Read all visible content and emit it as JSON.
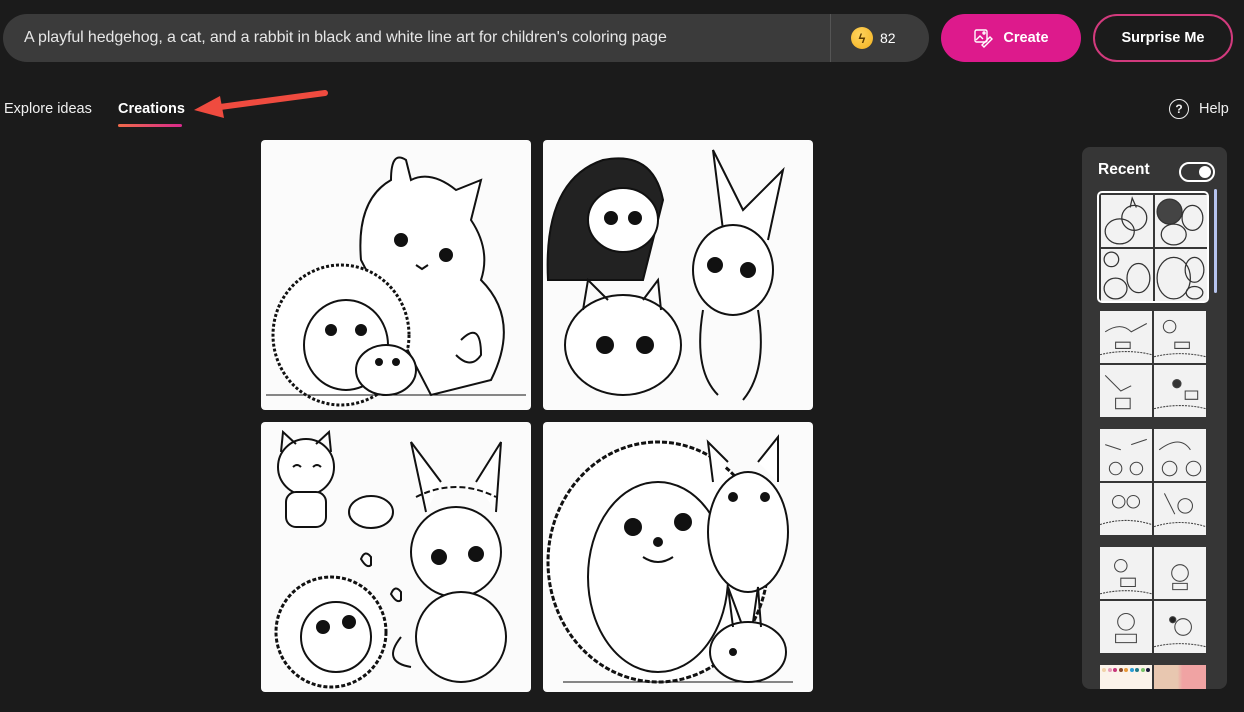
{
  "prompt": {
    "text": "A playful hedgehog, a cat, and a rabbit in black and white line art for children's coloring page"
  },
  "credits": {
    "icon": "lightning-coin-icon",
    "count": "82"
  },
  "buttons": {
    "create_label": "Create",
    "create_icon": "image-edit-icon",
    "surprise_label": "Surprise Me"
  },
  "tabs": [
    {
      "label": "Explore ideas",
      "active": false
    },
    {
      "label": "Creations",
      "active": true
    }
  ],
  "help": {
    "icon": "question-circle-icon",
    "label": "Help"
  },
  "annotation": {
    "arrow": "red-arrow-pointing-to-creations-tab"
  },
  "creations": [
    {
      "description": "Hedgehog, cat and rabbit line art - cat behind hedgehog, small rabbit front"
    },
    {
      "description": "Hedgehog waving, rabbit with long ears, cat lying in front"
    },
    {
      "description": "Smiling cat with bunny, hedgehog, rabbit with flower crown"
    },
    {
      "description": "Large standing hedgehog, cat and rabbit on the right"
    }
  ],
  "recent": {
    "title": "Recent",
    "toggle_on": true,
    "groups": [
      {
        "theme": "hedgehog cat rabbit",
        "selected": true
      },
      {
        "theme": "hummingbirds and tea cup",
        "selected": false
      },
      {
        "theme": "hummingbirds and flowers",
        "selected": false
      },
      {
        "theme": "birds with honey pot in flowers",
        "selected": false
      },
      {
        "theme": "color palette and photo",
        "selected": false
      }
    ],
    "palette_colors": [
      "#f1d3a8",
      "#e79bb8",
      "#c7367a",
      "#8b4a2b",
      "#e99a3a",
      "#2a9dd6",
      "#1f7a8a",
      "#7ac36a",
      "#1a1a3a",
      "#e8b24a"
    ]
  },
  "colors": {
    "background": "#1b1b1b",
    "accent_pink": "#dd1a8c",
    "surprise_border": "#d23a7d",
    "panel": "#363636",
    "prompt_bg": "#3b3b3b",
    "arrow": "#ef4b3f"
  }
}
